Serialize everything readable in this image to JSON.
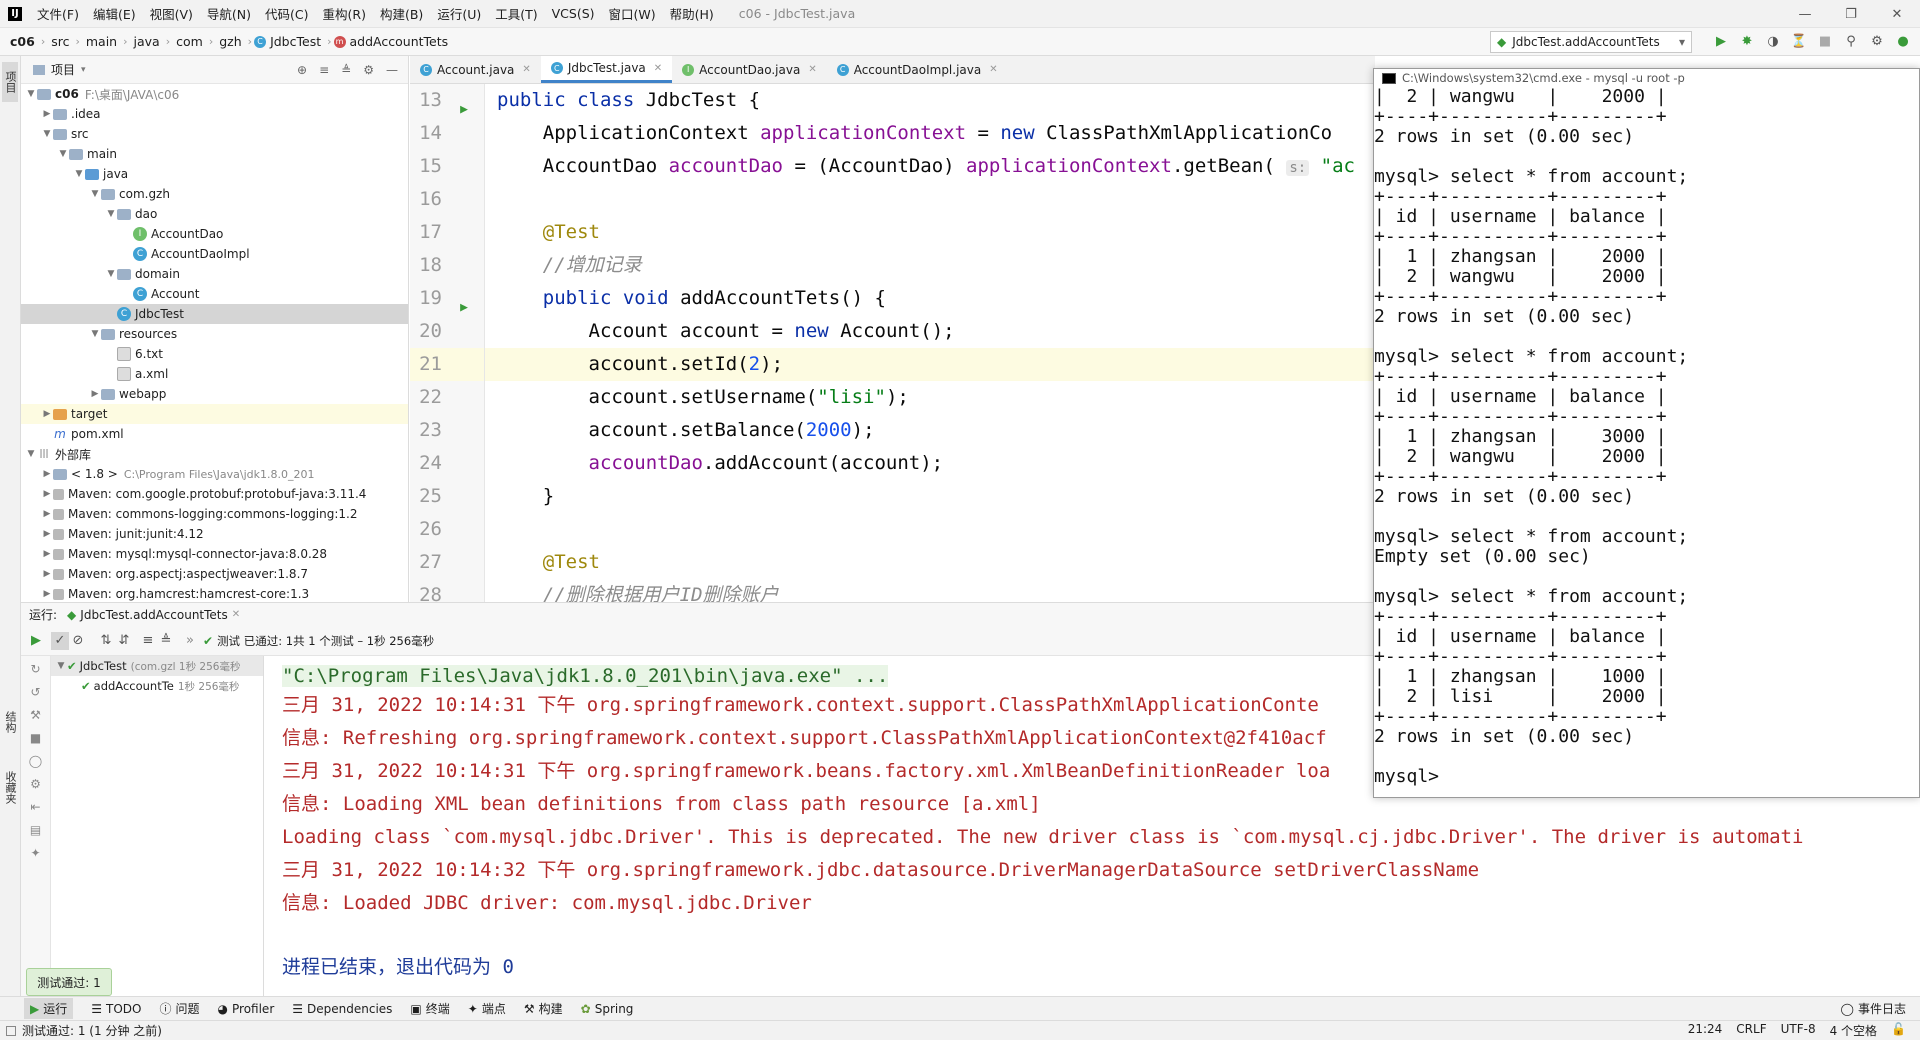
{
  "menubar": {
    "items": [
      "文件(F)",
      "编辑(E)",
      "视图(V)",
      "导航(N)",
      "代码(C)",
      "重构(R)",
      "构建(B)",
      "运行(U)",
      "工具(T)",
      "VCS(S)",
      "窗口(W)",
      "帮助(H)"
    ],
    "window_title": "c06 - JdbcTest.java"
  },
  "navbar": {
    "crumbs": [
      "c06",
      "src",
      "main",
      "java",
      "com",
      "gzh",
      "JdbcTest",
      "addAccountTets"
    ],
    "run_config": "JdbcTest.addAccountTets"
  },
  "left_strip": {
    "project": "项目",
    "structure": "结构",
    "favorites": "收藏夹"
  },
  "project": {
    "header": "项目",
    "rows": [
      {
        "label": "c06",
        "extra": "F:\\桌面\\JAVA\\c06"
      },
      {
        "label": ".idea",
        "extra": ""
      },
      {
        "label": "src",
        "extra": ""
      },
      {
        "label": "main",
        "extra": ""
      },
      {
        "label": "java",
        "extra": ""
      },
      {
        "label": "com.gzh",
        "extra": ""
      },
      {
        "label": "dao",
        "extra": ""
      },
      {
        "label": "AccountDao",
        "extra": ""
      },
      {
        "label": "AccountDaoImpl",
        "extra": ""
      },
      {
        "label": "domain",
        "extra": ""
      },
      {
        "label": "Account",
        "extra": ""
      },
      {
        "label": "JdbcTest",
        "extra": ""
      },
      {
        "label": "resources",
        "extra": ""
      },
      {
        "label": "6.txt",
        "extra": ""
      },
      {
        "label": "a.xml",
        "extra": ""
      },
      {
        "label": "webapp",
        "extra": ""
      },
      {
        "label": "target",
        "extra": ""
      },
      {
        "label": "pom.xml",
        "extra": ""
      },
      {
        "label": "外部库",
        "extra": ""
      },
      {
        "label": "< 1.8 >",
        "extra": "C:\\Program Files\\Java\\jdk1.8.0_201"
      },
      {
        "label": "Maven: com.google.protobuf:protobuf-java:3.11.4",
        "extra": ""
      },
      {
        "label": "Maven: commons-logging:commons-logging:1.2",
        "extra": ""
      },
      {
        "label": "Maven: junit:junit:4.12",
        "extra": ""
      },
      {
        "label": "Maven: mysql:mysql-connector-java:8.0.28",
        "extra": ""
      },
      {
        "label": "Maven: org.aspectj:aspectjweaver:1.8.7",
        "extra": ""
      },
      {
        "label": "Maven: org.hamcrest:hamcrest-core:1.3",
        "extra": ""
      }
    ]
  },
  "editor_tabs": [
    "Account.java",
    "JdbcTest.java",
    "AccountDao.java",
    "AccountDaoImpl.java"
  ],
  "editor": {
    "line_numbers": [
      "13",
      "14",
      "15",
      "16",
      "17",
      "18",
      "19",
      "20",
      "21",
      "22",
      "23",
      "24",
      "25",
      "26",
      "27",
      "28"
    ],
    "parts": {
      "public": "public",
      "class": "class",
      "void": "void",
      "new": "new",
      "class_name": " JdbcTest {",
      "appctx_type": "ApplicationContext ",
      "appctx_field": "applicationContext",
      "eq": " = ",
      "cpxac": " ClassPathXmlApplicationCo",
      "dao_type": "AccountDao ",
      "dao_field": "accountDao",
      "cast": " = (AccountDao) ",
      "getbean": ".getBean(",
      "hint_s": "s:",
      "str_ac": " \"ac",
      "test_ann": "@Test",
      "comment_add": "//增加记录",
      "method": " addAccountTets() {",
      "new_account_pre": "Account account = ",
      "new_account_post": " Account();",
      "setid_pre": "account.setId(",
      "setid_num": "2",
      "setid_post": ");",
      "setusername_pre": "account.setUsername(",
      "setusername_str": "\"lisi\"",
      "setusername_post": ");",
      "setbalance_pre": "account.setBalance(",
      "setbalance_num": "2000",
      "setbalance_post": ");",
      "addaccount_field": "accountDao",
      "addaccount_post": ".addAccount(account);",
      "close_brace": "}",
      "comment_del": "//删除根据用户ID删除账户"
    }
  },
  "run": {
    "header_label": "运行:",
    "tab": "JdbcTest.addAccountTets",
    "status": "测试 已通过: 1共 1 个测试 – 1秒 256毫秒",
    "tree_root": "JdbcTest",
    "tree_root_extra": "(com.gzl 1秒 256毫秒",
    "tree_child": "addAccountTe",
    "tree_child_extra": "1秒 256毫秒",
    "console": [
      "\"C:\\Program Files\\Java\\jdk1.8.0_201\\bin\\java.exe\" ...",
      "三月 31, 2022 10:14:31 下午 org.springframework.context.support.ClassPathXmlApplicationConte",
      "信息: Refreshing org.springframework.context.support.ClassPathXmlApplicationContext@2f410acf",
      "三月 31, 2022 10:14:31 下午 org.springframework.beans.factory.xml.XmlBeanDefinitionReader loa",
      "信息: Loading XML bean definitions from class path resource [a.xml]",
      "Loading class `com.mysql.jdbc.Driver'. This is deprecated. The new driver class is `com.mysql.cj.jdbc.Driver'. The driver is automati",
      "三月 31, 2022 10:14:32 下午 org.springframework.jdbc.datasource.DriverManagerDataSource setDriverClassName",
      "信息: Loaded JDBC driver: com.mysql.jdbc.Driver",
      "",
      "进程已结束，退出代码为 0"
    ]
  },
  "cmd": {
    "title": "C:\\Windows\\system32\\cmd.exe - mysql  -u root -p",
    "lines": [
      "|  2 | wangwu   |    2000 |",
      "+----+----------+---------+",
      "2 rows in set (0.00 sec)",
      "",
      "mysql> select * from account;",
      "+----+----------+---------+",
      "| id | username | balance |",
      "+----+----------+---------+",
      "|  1 | zhangsan |    2000 |",
      "|  2 | wangwu   |    2000 |",
      "+----+----------+---------+",
      "2 rows in set (0.00 sec)",
      "",
      "mysql> select * from account;",
      "+----+----------+---------+",
      "| id | username | balance |",
      "+----+----------+---------+",
      "|  1 | zhangsan |    3000 |",
      "|  2 | wangwu   |    2000 |",
      "+----+----------+---------+",
      "2 rows in set (0.00 sec)",
      "",
      "mysql> select * from account;",
      "Empty set (0.00 sec)",
      "",
      "mysql> select * from account;",
      "+----+----------+---------+",
      "| id | username | balance |",
      "+----+----------+---------+",
      "|  1 | zhangsan |    1000 |",
      "|  2 | lisi     |    2000 |",
      "+----+----------+---------+",
      "2 rows in set (0.00 sec)",
      "",
      "mysql>"
    ]
  },
  "popup": "测试通过: 1",
  "toolwin": [
    "运行",
    "TODO",
    "问题",
    "Profiler",
    "Dependencies",
    "终端",
    "端点",
    "构建",
    "Spring"
  ],
  "status": {
    "left": "测试通过: 1 (1 分钟 之前)",
    "position": "21:24",
    "line_sep": "CRLF",
    "encoding": "UTF-8",
    "indent": "4 个空格",
    "event_log": "事件日志"
  }
}
